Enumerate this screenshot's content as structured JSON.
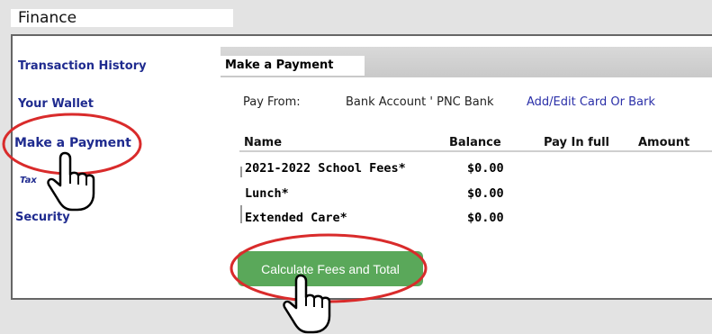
{
  "window": {
    "title": "Finance"
  },
  "sidebar": {
    "items": [
      {
        "label": "Transaction History"
      },
      {
        "label": "Your Wallet"
      },
      {
        "label": "Make a Payment"
      },
      {
        "label": "Tax"
      },
      {
        "label": "Security"
      }
    ]
  },
  "panel": {
    "tab_label": "Make a Payment",
    "pay_from_label": "Pay From:",
    "pay_from_value": "Bank Account ' PNC Bank",
    "edit_link": "Add/Edit Card Or Bark"
  },
  "table": {
    "columns": [
      "Name",
      "Balance",
      "Pay In full",
      "Amount"
    ],
    "rows": [
      {
        "name": "2021-2022 School Fees*",
        "balance": "$0.00"
      },
      {
        "name": "Lunch*",
        "balance": "$0.00"
      },
      {
        "name": "Extended Care*",
        "balance": "$0.00"
      }
    ]
  },
  "actions": {
    "calculate_label": "Calculate Fees and Total"
  },
  "colors": {
    "nav_text": "#1f2b8f",
    "button_green": "#5aa85a",
    "highlight_red": "#d92b2b"
  }
}
